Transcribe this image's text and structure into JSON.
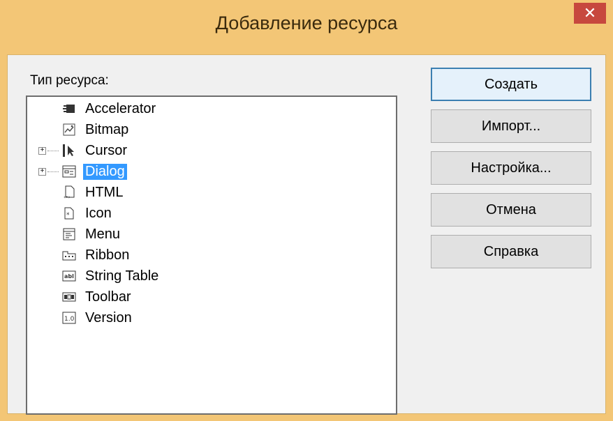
{
  "window": {
    "title": "Добавление ресурса",
    "close_label": "✕"
  },
  "resource_type_label": "Тип ресурса:",
  "tree": {
    "items": [
      {
        "label": "Accelerator",
        "icon": "accelerator-icon",
        "expandable": false,
        "selected": false
      },
      {
        "label": "Bitmap",
        "icon": "bitmap-icon",
        "expandable": false,
        "selected": false
      },
      {
        "label": "Cursor",
        "icon": "cursor-icon",
        "expandable": true,
        "selected": false
      },
      {
        "label": "Dialog",
        "icon": "dialog-icon",
        "expandable": true,
        "selected": true
      },
      {
        "label": "HTML",
        "icon": "html-icon",
        "expandable": false,
        "selected": false
      },
      {
        "label": "Icon",
        "icon": "icon-resource-icon",
        "expandable": false,
        "selected": false
      },
      {
        "label": "Menu",
        "icon": "menu-icon",
        "expandable": false,
        "selected": false
      },
      {
        "label": "Ribbon",
        "icon": "ribbon-icon",
        "expandable": false,
        "selected": false
      },
      {
        "label": "String Table",
        "icon": "string-table-icon",
        "expandable": false,
        "selected": false
      },
      {
        "label": "Toolbar",
        "icon": "toolbar-icon",
        "expandable": false,
        "selected": false
      },
      {
        "label": "Version",
        "icon": "version-icon",
        "expandable": false,
        "selected": false
      }
    ]
  },
  "buttons": {
    "create": "Создать",
    "import": "Импорт...",
    "customize": "Настройка...",
    "cancel": "Отмена",
    "help": "Справка"
  },
  "colors": {
    "frame": "#f3c676",
    "close": "#c7483e",
    "selection": "#3399ff"
  }
}
